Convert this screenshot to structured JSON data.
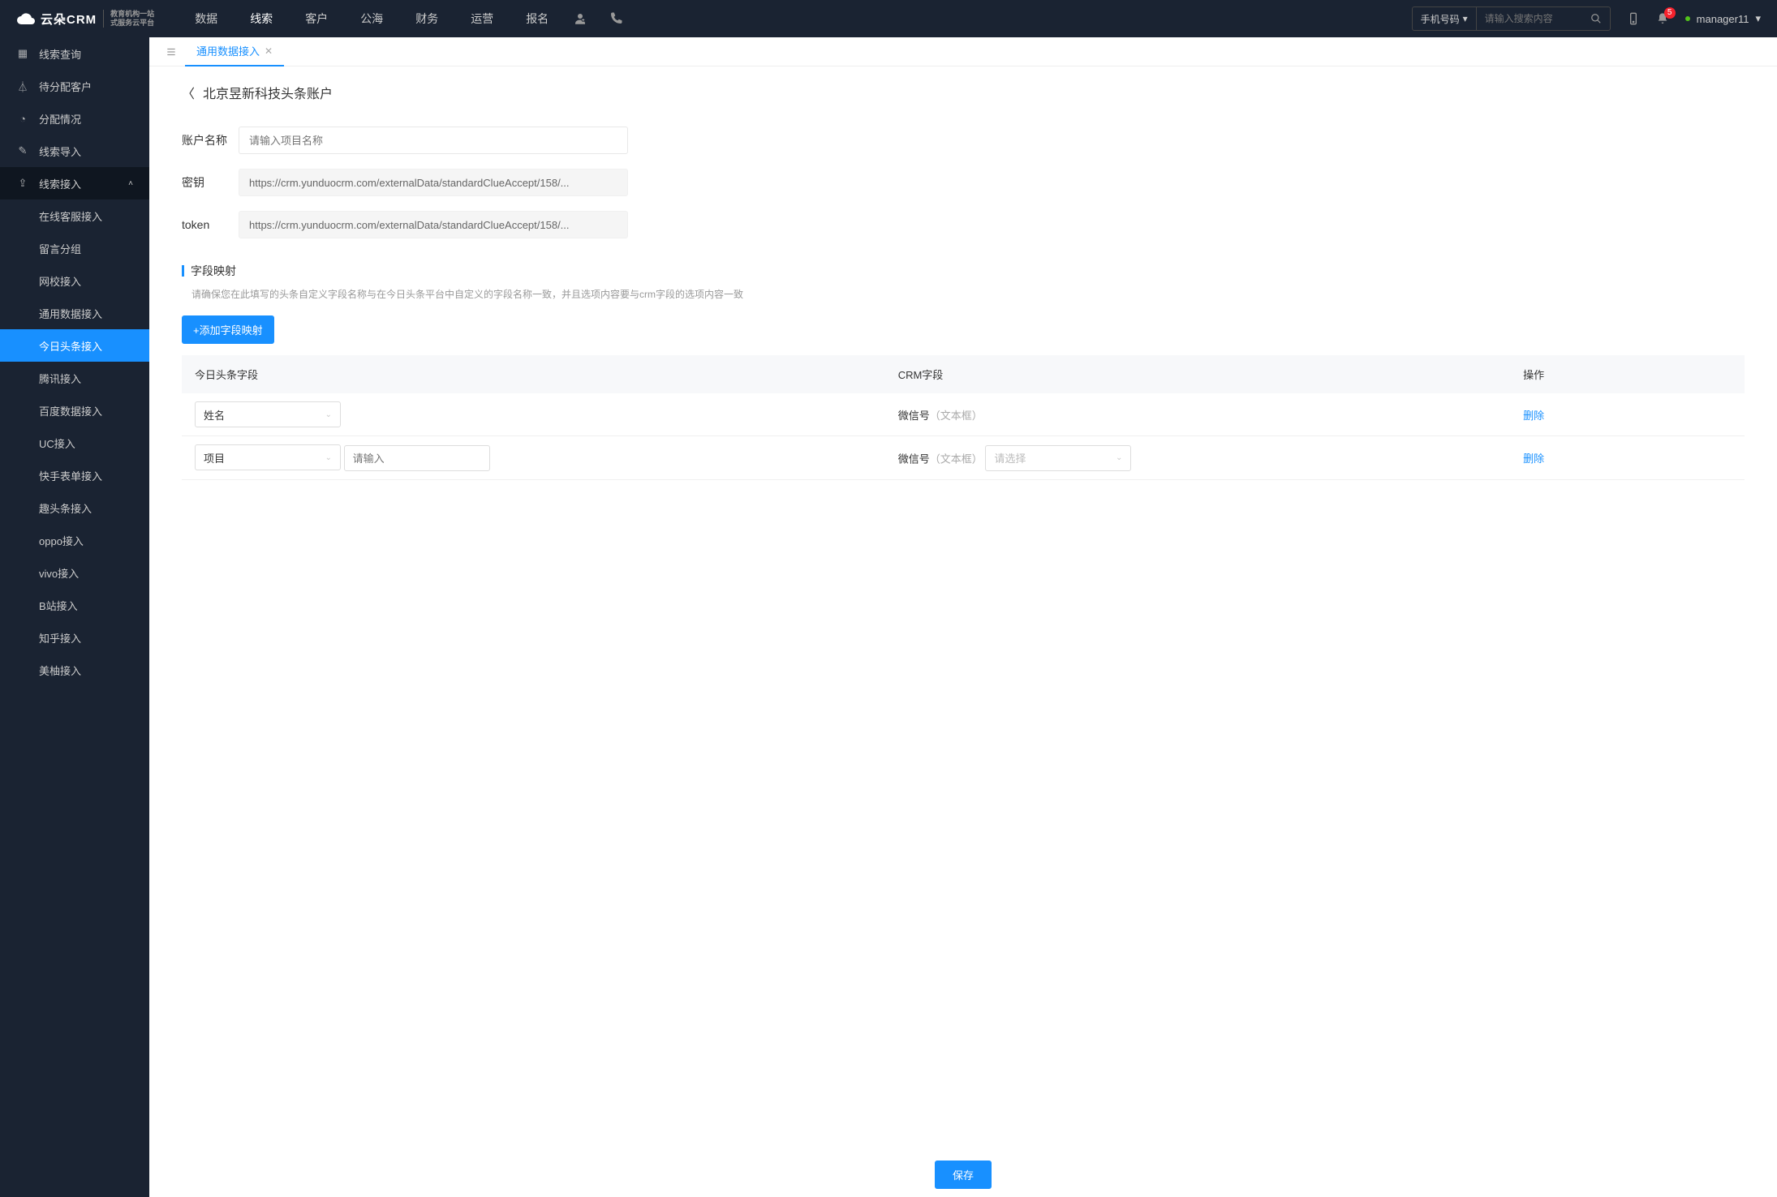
{
  "header": {
    "logo": "云朵CRM",
    "logo_sub1": "教育机构一站",
    "logo_sub2": "式服务云平台",
    "nav": [
      "数据",
      "线索",
      "客户",
      "公海",
      "财务",
      "运营",
      "报名"
    ],
    "nav_active_index": 1,
    "search_type": "手机号码",
    "search_ph": "请输入搜索内容",
    "notif_count": "5",
    "user": "manager11"
  },
  "sidebar": {
    "items": [
      {
        "label": "线索查询"
      },
      {
        "label": "待分配客户"
      },
      {
        "label": "分配情况"
      },
      {
        "label": "线索导入"
      },
      {
        "label": "线索接入",
        "expanded": true,
        "children": [
          {
            "label": "在线客服接入"
          },
          {
            "label": "留言分组"
          },
          {
            "label": "网校接入"
          },
          {
            "label": "通用数据接入"
          },
          {
            "label": "今日头条接入",
            "selected": true
          },
          {
            "label": "腾讯接入"
          },
          {
            "label": "百度数据接入"
          },
          {
            "label": "UC接入"
          },
          {
            "label": "快手表单接入"
          },
          {
            "label": "趣头条接入"
          },
          {
            "label": "oppo接入"
          },
          {
            "label": "vivo接入"
          },
          {
            "label": "B站接入"
          },
          {
            "label": "知乎接入"
          },
          {
            "label": "美柚接入"
          }
        ]
      }
    ]
  },
  "tabs": {
    "active": "通用数据接入"
  },
  "page": {
    "title": "北京昱新科技头条账户",
    "form": {
      "name_label": "账户名称",
      "name_ph": "请输入项目名称",
      "key_label": "密钥",
      "key_val": "https://crm.yunduocrm.com/externalData/standardClueAccept/158/...",
      "token_label": "token",
      "token_val": "https://crm.yunduocrm.com/externalData/standardClueAccept/158/..."
    },
    "section": {
      "title": "字段映射",
      "desc": "请确保您在此填写的头条自定义字段名称与在今日头条平台中自定义的字段名称一致，并且选项内容要与crm字段的选项内容一致",
      "add_btn": "+添加字段映射"
    },
    "table": {
      "cols": [
        "今日头条字段",
        "CRM字段",
        "操作"
      ],
      "input_ph": "请输入",
      "select_ph": "请选择",
      "del": "删除",
      "rows": [
        {
          "tt_sel": "姓名",
          "crm_name": "微信号",
          "crm_type": "（文本框）",
          "has_extra": false
        },
        {
          "tt_sel": "项目",
          "crm_name": "微信号",
          "crm_type": "（文本框）",
          "has_extra": true
        }
      ]
    },
    "save": "保存"
  }
}
